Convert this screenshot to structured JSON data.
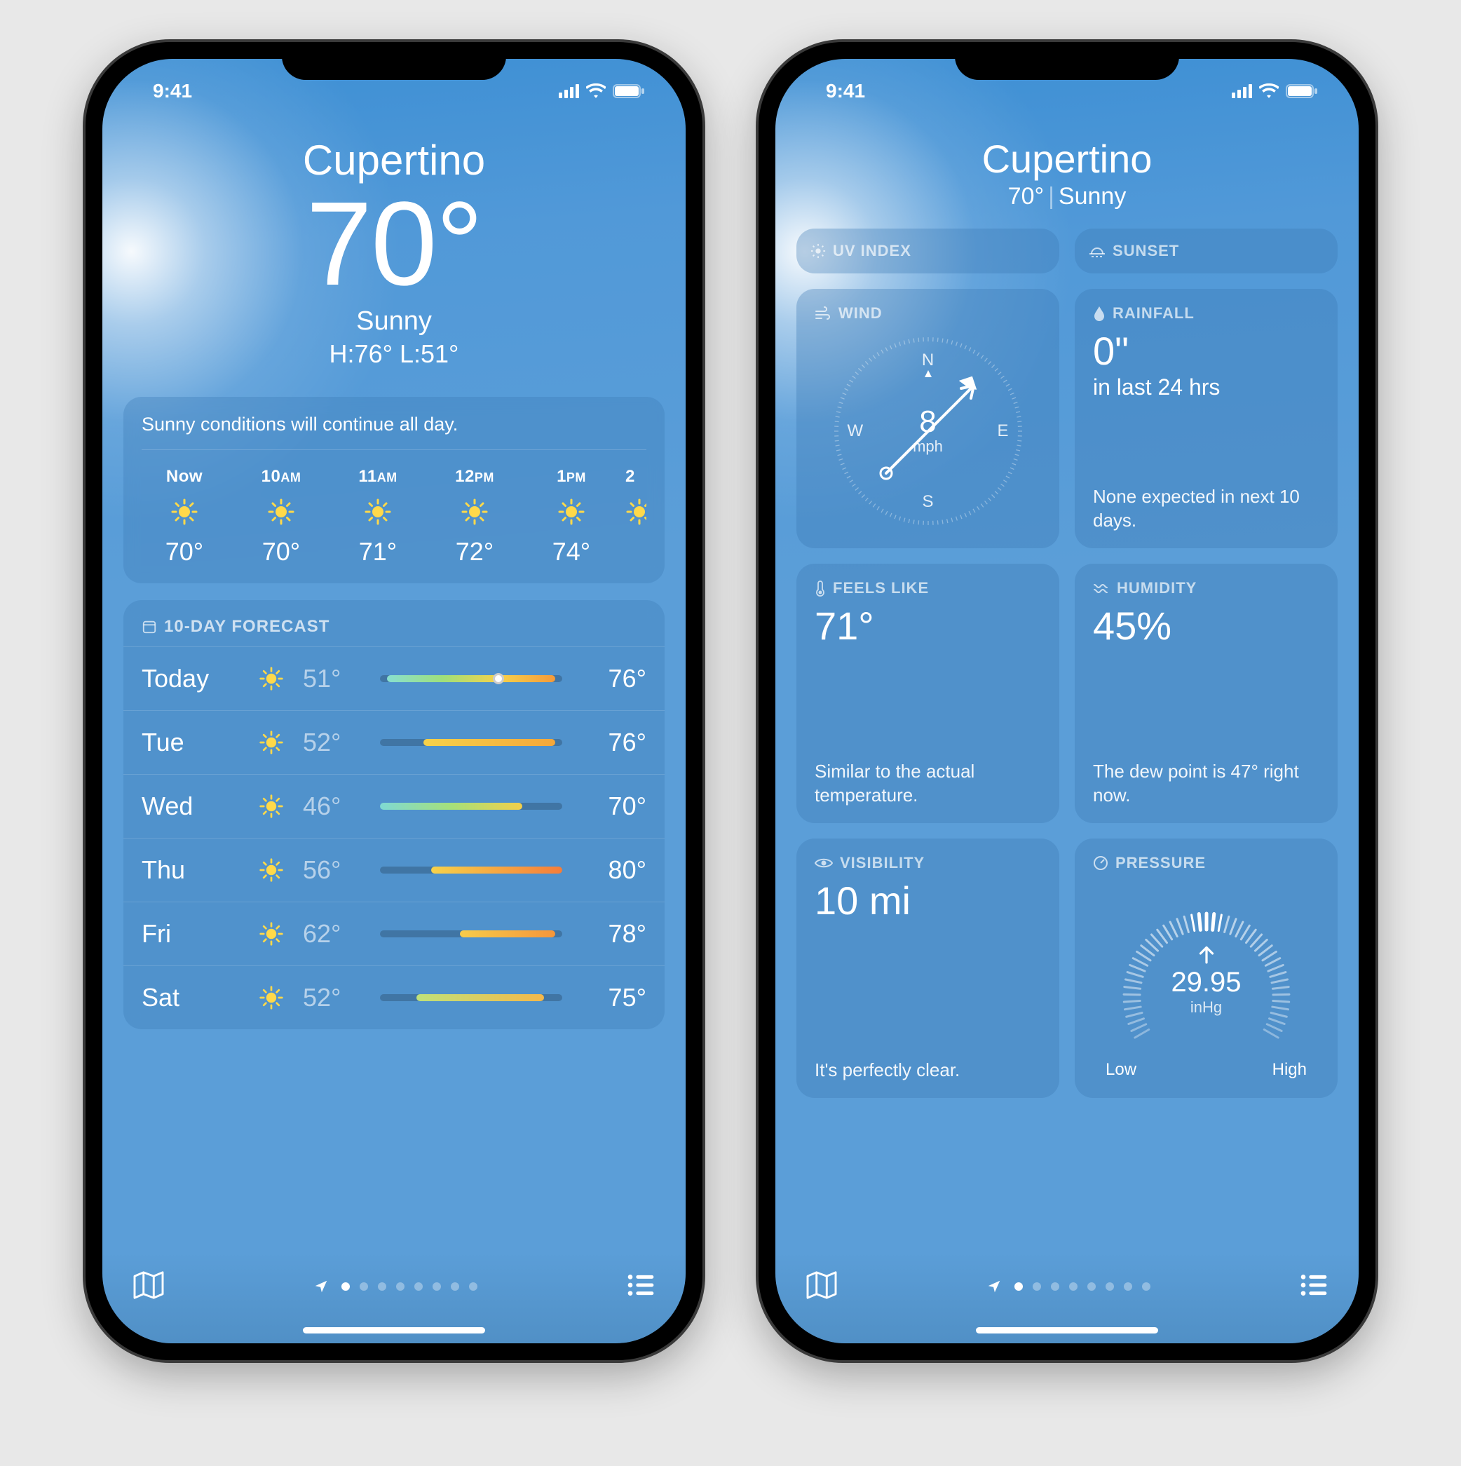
{
  "status": {
    "time": "9:41"
  },
  "phone1": {
    "location": "Cupertino",
    "temperature": "70°",
    "condition": "Sunny",
    "hilo": "H:76° L:51°",
    "hourly_msg": "Sunny conditions will continue all day.",
    "hourly": [
      {
        "time": "Now",
        "temp": "70°"
      },
      {
        "time": "10AM",
        "temp": "70°"
      },
      {
        "time": "11AM",
        "temp": "71°"
      },
      {
        "time": "12PM",
        "temp": "72°"
      },
      {
        "time": "1PM",
        "temp": "74°"
      },
      {
        "time": "2",
        "temp": ""
      }
    ],
    "tenday_label": "10-DAY FORECAST",
    "days": [
      {
        "name": "Today",
        "lo": "51°",
        "hi": "76°",
        "fillLeft": 4,
        "fillWidth": 92,
        "grad": "linear-gradient(90deg,#88e0d0,#9fe07a,#f7d24a,#f59a3a)",
        "dotLeft": 62
      },
      {
        "name": "Tue",
        "lo": "52°",
        "hi": "76°",
        "fillLeft": 24,
        "fillWidth": 72,
        "grad": "linear-gradient(90deg,#f7d24a,#f5a73a)"
      },
      {
        "name": "Wed",
        "lo": "46°",
        "hi": "70°",
        "fillLeft": 0,
        "fillWidth": 78,
        "grad": "linear-gradient(90deg,#7fd9d4,#a5e07a,#f3cf4a)"
      },
      {
        "name": "Thu",
        "lo": "56°",
        "hi": "80°",
        "fillLeft": 28,
        "fillWidth": 72,
        "grad": "linear-gradient(90deg,#f7d24a,#f57d3a)"
      },
      {
        "name": "Fri",
        "lo": "62°",
        "hi": "78°",
        "fillLeft": 44,
        "fillWidth": 52,
        "grad": "linear-gradient(90deg,#f7cc4a,#f5963a)"
      },
      {
        "name": "Sat",
        "lo": "52°",
        "hi": "75°",
        "fillLeft": 20,
        "fillWidth": 70,
        "grad": "linear-gradient(90deg,#bfe27a,#f5b84a)"
      }
    ]
  },
  "phone2": {
    "location": "Cupertino",
    "sub_temp": "70°",
    "sub_cond": "Sunny",
    "cards": {
      "uv": {
        "title": "UV INDEX"
      },
      "sunset": {
        "title": "SUNSET"
      },
      "wind": {
        "title": "WIND",
        "value": "8",
        "unit": "mph"
      },
      "rainfall": {
        "title": "RAINFALL",
        "value": "0\"",
        "sub": "in last 24 hrs",
        "desc": "None expected in next 10 days."
      },
      "feels": {
        "title": "FEELS LIKE",
        "value": "71°",
        "desc": "Similar to the actual temperature."
      },
      "humidity": {
        "title": "HUMIDITY",
        "value": "45%",
        "desc": "The dew point is 47° right now."
      },
      "visibility": {
        "title": "VISIBILITY",
        "value": "10 mi",
        "desc": "It's perfectly clear."
      },
      "pressure": {
        "title": "PRESSURE",
        "value": "29.95",
        "unit": "inHg",
        "low": "Low",
        "high": "High"
      }
    }
  }
}
